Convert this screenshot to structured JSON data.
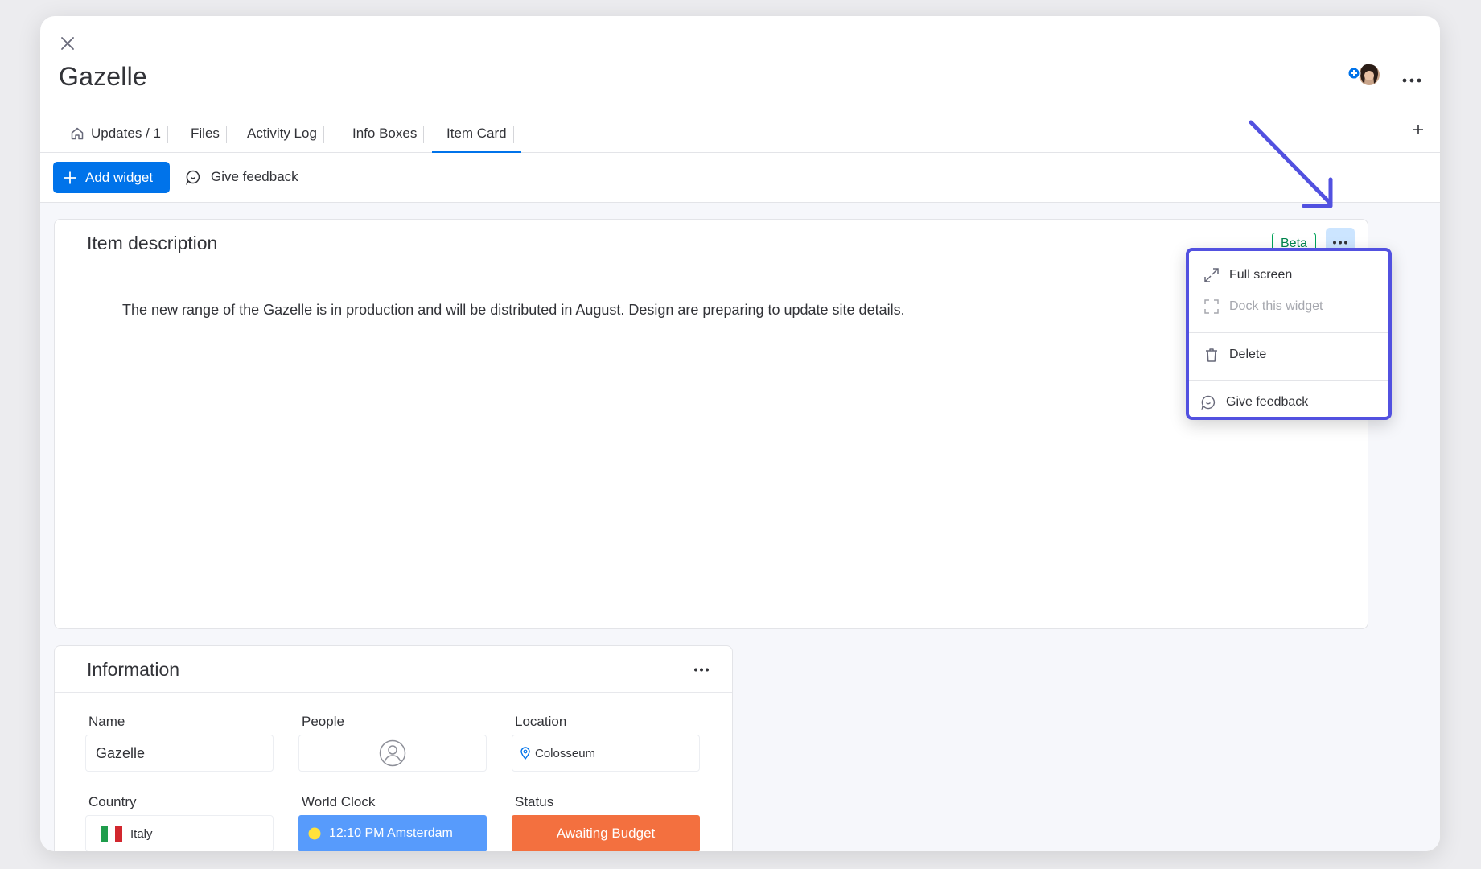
{
  "item": {
    "title": "Gazelle"
  },
  "tabs": [
    {
      "label": "Updates / 1"
    },
    {
      "label": "Files"
    },
    {
      "label": "Activity Log"
    },
    {
      "label": "Info Boxes"
    },
    {
      "label": "Item Card"
    }
  ],
  "toolbar": {
    "add_widget_label": "Add widget",
    "give_feedback_label": "Give feedback"
  },
  "description_widget": {
    "title": "Item description",
    "badge": "Beta",
    "text": "The new range of the Gazelle is in production and will be distributed in August. Design are preparing to update site details."
  },
  "widget_menu": {
    "items": [
      {
        "label": "Full screen",
        "icon": "expand-icon",
        "enabled": true
      },
      {
        "label": "Dock this widget",
        "icon": "dock-icon",
        "enabled": false
      },
      {
        "label": "Delete",
        "icon": "trash-icon",
        "enabled": true
      },
      {
        "label": "Give feedback",
        "icon": "feedback-icon",
        "enabled": true
      }
    ]
  },
  "information_widget": {
    "title": "Information",
    "fields": {
      "name": {
        "label": "Name",
        "value": "Gazelle"
      },
      "people": {
        "label": "People"
      },
      "location": {
        "label": "Location",
        "value": "Colosseum"
      },
      "country": {
        "label": "Country",
        "value": "Italy"
      },
      "world_clock": {
        "label": "World Clock",
        "value": "12:10 PM Amsterdam"
      },
      "status": {
        "label": "Status",
        "value": "Awaiting Budget"
      }
    }
  },
  "colors": {
    "primary": "#0073ea",
    "active_tab_underline": "#0073ea",
    "beta_green": "#00a359",
    "highlight_purple": "#5251e0",
    "clock_blue": "#579bfc",
    "status_orange": "#f3703f"
  }
}
